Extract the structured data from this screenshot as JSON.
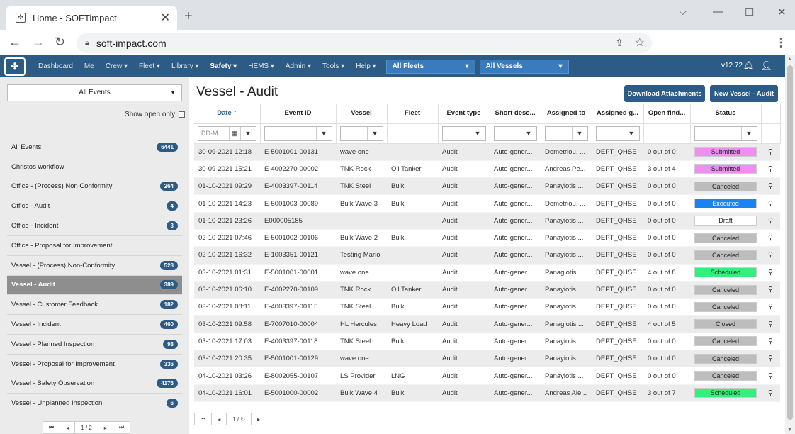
{
  "browser": {
    "tab_title": "Home - SOFTimpact",
    "tab_close": "✕",
    "new_tab": "+",
    "url": "soft-impact.com",
    "minimize": "—",
    "maximize": "☐",
    "close": "✕",
    "chevron": "⌵"
  },
  "nav": {
    "items": [
      "Dashboard",
      "Me",
      "Crew ▾",
      "Fleet ▾",
      "Library ▾",
      "Safety ▾",
      "HEMS ▾",
      "Admin ▾",
      "Tools ▾",
      "Help ▾"
    ],
    "active_index": 5,
    "fleets_select": "All Fleets",
    "vessels_select": "All Vessels",
    "version": "v12.72"
  },
  "sidebar": {
    "event_select": "All Events",
    "show_open_label": "Show open only",
    "items": [
      {
        "label": "All Events",
        "count": "6441"
      },
      {
        "label": "Christos workflow",
        "count": ""
      },
      {
        "label": "Office - (Process) Non Conformity",
        "count": "264"
      },
      {
        "label": "Office - Audit",
        "count": "4"
      },
      {
        "label": "Office - Incident",
        "count": "3"
      },
      {
        "label": "Office - Proposal for Improvement",
        "count": ""
      },
      {
        "label": "Vessel - (Process) Non-Conformity",
        "count": "528"
      },
      {
        "label": "Vessel - Audit",
        "count": "389"
      },
      {
        "label": "Vessel - Customer Feedback",
        "count": "182"
      },
      {
        "label": "Vessel - Incident",
        "count": "460"
      },
      {
        "label": "Vessel - Planned Inspection",
        "count": "93"
      },
      {
        "label": "Vessel - Proposal for Improvement",
        "count": "336"
      },
      {
        "label": "Vessel - Safety Observation",
        "count": "4176"
      },
      {
        "label": "Vessel - Unplanned Inspection",
        "count": "6"
      }
    ],
    "active_index": 7,
    "pager": [
      "⏮",
      "◂",
      "1 / 2",
      "▸",
      "⏭"
    ]
  },
  "main": {
    "title": "Vessel - Audit",
    "download_btn": "Download Attachments",
    "new_btn": "New Vessel - Audit",
    "date_placeholder": "DD-M...",
    "columns": [
      "Date ↑",
      "Event ID",
      "Vessel",
      "Fleet",
      "Event type",
      "Short desc...",
      "Assigned to",
      "Assigned g...",
      "Open find...",
      "Status"
    ],
    "rows": [
      [
        "30-09-2021 12:18",
        "E-5001001-00131",
        "wave one",
        "",
        "Audit",
        "Auto-gener...",
        "Demetriou, ...",
        "DEPT_QHSE",
        "0 out of 0",
        "Submitted"
      ],
      [
        "30-09-2021 15:21",
        "E-4002270-00002",
        "TNK Rock",
        "Oil Tanker",
        "Audit",
        "Auto-gener...",
        "Andreas Pe...",
        "DEPT_QHSE",
        "3 out of 4",
        "Submitted"
      ],
      [
        "01-10-2021 09:29",
        "E-4003397-00114",
        "TNK Steel",
        "Bulk",
        "Audit",
        "Auto-gener...",
        "Panayiotis ...",
        "DEPT_QHSE",
        "0 out of 0",
        "Canceled"
      ],
      [
        "01-10-2021 14:23",
        "E-5001003-00089",
        "Bulk Wave 3",
        "Bulk",
        "Audit",
        "Auto-gener...",
        "Demetriou, ...",
        "DEPT_QHSE",
        "0 out of 0",
        "Executed"
      ],
      [
        "01-10-2021 23:26",
        "E000005185",
        "",
        "",
        "Audit",
        "Auto-gener...",
        "Panayiotis ...",
        "DEPT_QHSE",
        "0 out of 0",
        "Draft"
      ],
      [
        "02-10-2021 07:46",
        "E-5001002-00106",
        "Bulk Wave 2",
        "Bulk",
        "Audit",
        "Auto-gener...",
        "Panayiotis ...",
        "DEPT_QHSE",
        "0 out of 0",
        "Canceled"
      ],
      [
        "02-10-2021 16:32",
        "E-1003351-00121",
        "Testing Mario",
        "",
        "Audit",
        "Auto-gener...",
        "Panayiotis ...",
        "DEPT_QHSE",
        "0 out of 0",
        "Canceled"
      ],
      [
        "03-10-2021 01:31",
        "E-5001001-00001",
        "wave one",
        "",
        "Audit",
        "Auto-gener...",
        "Panagiotis ...",
        "DEPT_QHSE",
        "4 out of 8",
        "Scheduled"
      ],
      [
        "03-10-2021 06:10",
        "E-4002270-00109",
        "TNK Rock",
        "Oil Tanker",
        "Audit",
        "Auto-gener...",
        "Panayiotis ...",
        "DEPT_QHSE",
        "0 out of 0",
        "Canceled"
      ],
      [
        "03-10-2021 08:11",
        "E-4003397-00115",
        "TNK Steel",
        "Bulk",
        "Audit",
        "Auto-gener...",
        "Panayiotis ...",
        "DEPT_QHSE",
        "0 out of 0",
        "Canceled"
      ],
      [
        "03-10-2021 09:58",
        "E-7007010-00004",
        "HL Hercules",
        "Heavy Load",
        "Audit",
        "Auto-gener...",
        "Panagiotis ...",
        "DEPT_QHSE",
        "4 out of 5",
        "Closed"
      ],
      [
        "03-10-2021 17:03",
        "E-4003397-00118",
        "TNK Steel",
        "Bulk",
        "Audit",
        "Auto-gener...",
        "Panayiotis ...",
        "DEPT_QHSE",
        "0 out of 0",
        "Canceled"
      ],
      [
        "03-10-2021 20:35",
        "E-5001001-00129",
        "wave one",
        "",
        "Audit",
        "Auto-gener...",
        "Panayiotis ...",
        "DEPT_QHSE",
        "0 out of 0",
        "Canceled"
      ],
      [
        "04-10-2021 03:26",
        "E-8002055-00107",
        "LS Provider",
        "LNG",
        "Audit",
        "Auto-gener...",
        "Panayiotis ...",
        "DEPT_QHSE",
        "0 out of 0",
        "Canceled"
      ],
      [
        "04-10-2021 16:01",
        "E-5001000-00002",
        "Bulk Wave 4",
        "Bulk",
        "Audit",
        "Auto-gener...",
        "Andreas Ale...",
        "DEPT_QHSE",
        "3 out of 7",
        "Scheduled"
      ]
    ],
    "status_colors": {
      "Submitted": "#f08ef0",
      "Canceled": "#bdbdbd",
      "Executed": "#1a82f2",
      "Draft": "#ffffff",
      "Scheduled": "#33ef7d",
      "Closed": "#bdbdbd"
    },
    "pager": [
      "⏮",
      "◂",
      "1 / ↻",
      "▸"
    ]
  }
}
